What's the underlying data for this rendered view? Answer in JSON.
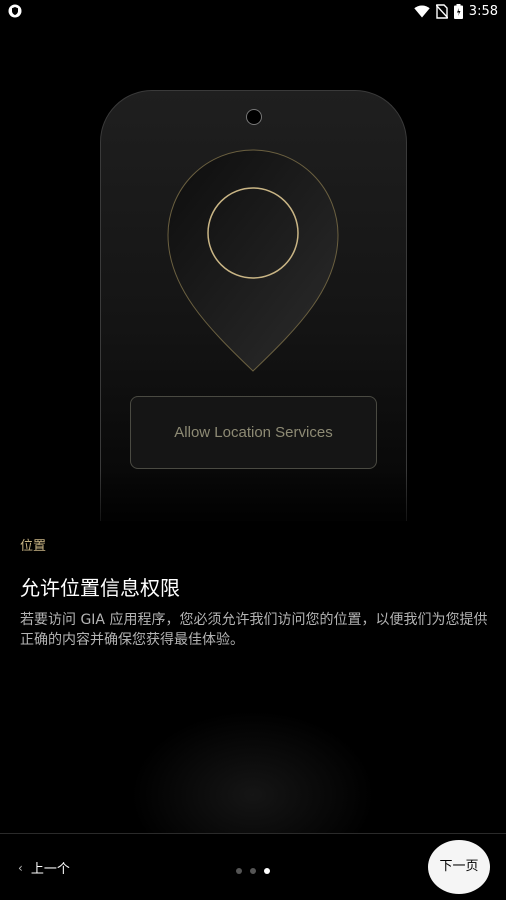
{
  "status_bar": {
    "time": "3:58",
    "icons": [
      "shield-icon",
      "wifi-icon",
      "no-sim-icon",
      "battery-icon"
    ]
  },
  "hero": {
    "button_label": "Allow Location Services",
    "accent_color": "#c9b585"
  },
  "content": {
    "eyebrow": "位置",
    "title": "允许位置信息权限",
    "description": "若要访问 GIA 应用程序，您必须允许我们访问您的位置，以便我们为您提供正确的内容并确保您获得最佳体验。"
  },
  "nav": {
    "prev_label": "上一个",
    "next_label": "下一页",
    "page_dots": 3,
    "active_page": 3
  }
}
